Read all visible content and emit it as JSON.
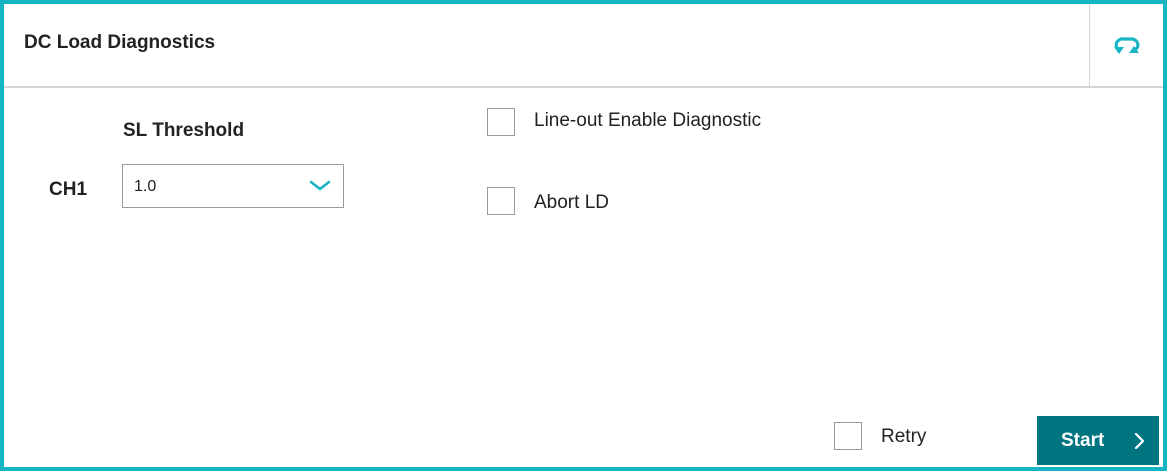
{
  "panel": {
    "title": "DC Load Diagnostics",
    "refresh_icon": "refresh-icon"
  },
  "threshold": {
    "heading": "SL Threshold",
    "channel_label": "CH1",
    "selected_value": "1.0",
    "dropdown_icon": "chevron-down-icon"
  },
  "options": {
    "line_out_label": "Line-out Enable Diagnostic",
    "line_out_checked": false,
    "abort_label": "Abort LD",
    "abort_checked": false
  },
  "footer": {
    "retry_label": "Retry",
    "retry_checked": false,
    "start_label": "Start",
    "start_icon": "chevron-right-icon"
  },
  "colors": {
    "accent": "#17b5c4",
    "start_button": "#00747f",
    "border": "#9a9a9a"
  }
}
